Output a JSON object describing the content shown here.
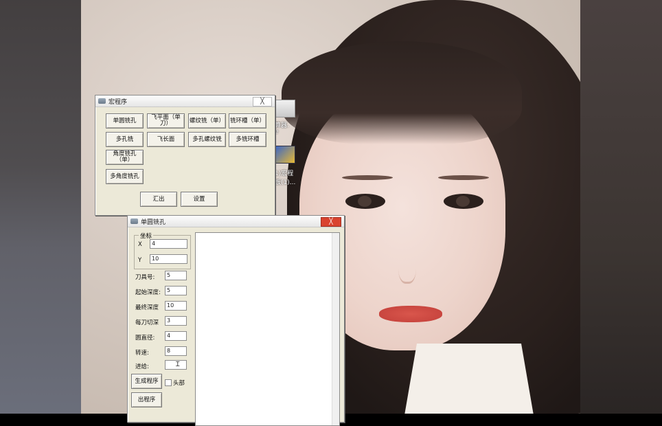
{
  "desktop": {
    "icons": [
      {
        "label": "算器."
      },
      {
        "label": "e"
      },
      {
        "label": "1)宏程"
      },
      {
        "label": "板(1)..."
      }
    ]
  },
  "macro_window": {
    "title": "宏程序",
    "close": "╳",
    "buttons": {
      "b1": "单圆铣孔",
      "b2": "飞平面（单刀）",
      "b3": "螺纹铣（单）",
      "b4": "铣环槽（单）",
      "b5": "多孔铣",
      "b6": "飞长面",
      "b7": "多孔螺纹铣",
      "b8": "多铣环槽",
      "b9": "角度铣孔（单）",
      "b10": "多角度铣孔",
      "export": "汇出",
      "settings": "设置"
    }
  },
  "hole_window": {
    "title": "单圆铣孔",
    "close": "╳",
    "coords": {
      "group_title": "坐标",
      "x_label": "X",
      "x_value": "4",
      "y_label": "Y",
      "y_value": "10"
    },
    "fields": {
      "tool_label": "刀具号:",
      "tool_value": "5",
      "start_depth_label": "起始深度:",
      "start_depth_value": "5",
      "final_depth_label": "最终深度",
      "final_depth_value": "10",
      "per_cut_label": "每刀切深",
      "per_cut_value": "3",
      "diameter_label": "圆直径:",
      "diameter_value": "4",
      "speed_label": "转速:",
      "speed_value": "8",
      "feed_label": "进给:",
      "feed_value": ""
    },
    "generate": "生成程序",
    "header_checkbox": "头部",
    "output": "出程序"
  }
}
